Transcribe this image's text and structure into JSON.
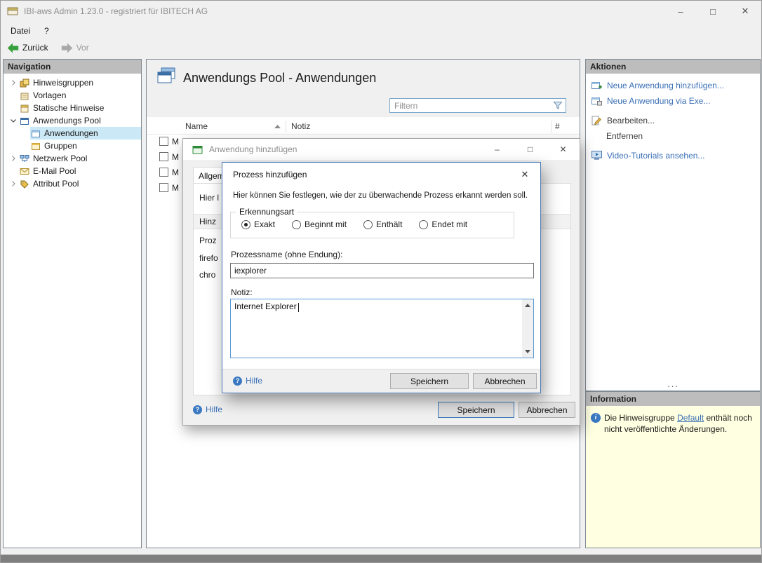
{
  "colors": {
    "accent_blue": "#4a7ab5",
    "link_blue": "#3a6fb5",
    "selection_blue": "#cbe8f6",
    "header_gray": "#bdbdbd",
    "info_yellow": "#ffffe1",
    "focus_blue": "#5b9bd5"
  },
  "icons": {
    "minimize": "–",
    "maximize": "□",
    "close": "✕",
    "dialog_close": "✕",
    "dots": "···",
    "help_glyph": "?",
    "info_glyph": "i"
  },
  "window": {
    "title": "IBI-aws Admin 1.23.0 - registriert für IBITECH AG"
  },
  "menu": {
    "items": [
      {
        "label": "Datei"
      },
      {
        "label": "?"
      }
    ]
  },
  "toolbar": {
    "back_label": "Zurück",
    "forward_label": "Vor"
  },
  "nav": {
    "header": "Navigation",
    "items": [
      {
        "label": "Hinweisgruppen"
      },
      {
        "label": "Vorlagen"
      },
      {
        "label": "Statische Hinweise"
      },
      {
        "label": "Anwendungs Pool"
      },
      {
        "label": "Anwendungen"
      },
      {
        "label": "Gruppen"
      },
      {
        "label": "Netzwerk Pool"
      },
      {
        "label": "E-Mail Pool"
      },
      {
        "label": "Attribut Pool"
      }
    ]
  },
  "main": {
    "title": "Anwendungs Pool - Anwendungen",
    "filter_placeholder": "Filtern",
    "table": {
      "columns": [
        {
          "label": "Name"
        },
        {
          "label": "Notiz"
        },
        {
          "label": "#"
        }
      ],
      "rows": [
        {
          "name_visible": "M"
        },
        {
          "name_visible": "M"
        },
        {
          "name_visible": "M"
        },
        {
          "name_visible": "M"
        }
      ]
    }
  },
  "actions": {
    "header": "Aktionen",
    "items": [
      {
        "label": "Neue Anwendung hinzufügen..."
      },
      {
        "label": "Neue Anwendung via Exe..."
      },
      {
        "label": "Bearbeiten..."
      },
      {
        "label": "Entfernen"
      },
      {
        "label": "Video-Tutorials ansehen..."
      }
    ]
  },
  "information": {
    "header": "Information",
    "text_before": "Die Hinweisgruppe",
    "link_text": "Default",
    "text_after": "enthält noch nicht veröffentlichte Änderungen."
  },
  "dialog_bg": {
    "title": "Anwendung hinzufügen",
    "tab_label": "Allgem",
    "fragments": {
      "line1": "Hier l",
      "band": "Hinz",
      "line2": "Proz",
      "line3": "firefo",
      "line4": "chro"
    },
    "help_label": "Hilfe",
    "save_label": "Speichern",
    "cancel_label": "Abbrechen"
  },
  "dialog": {
    "title": "Prozess hinzufügen",
    "description": "Hier können Sie festlegen, wie der zu überwachende Prozess erkannt werden soll.",
    "group_label": "Erkennungsart",
    "options": [
      {
        "label": "Exakt",
        "selected": true
      },
      {
        "label": "Beginnt mit",
        "selected": false
      },
      {
        "label": "Enthält",
        "selected": false
      },
      {
        "label": "Endet mit",
        "selected": false
      }
    ],
    "process_label": "Prozessname (ohne Endung):",
    "process_value": "iexplorer",
    "note_label": "Notiz:",
    "note_value": "Internet Explorer",
    "help_label": "Hilfe",
    "save_label": "Speichern",
    "cancel_label": "Abbrechen"
  }
}
